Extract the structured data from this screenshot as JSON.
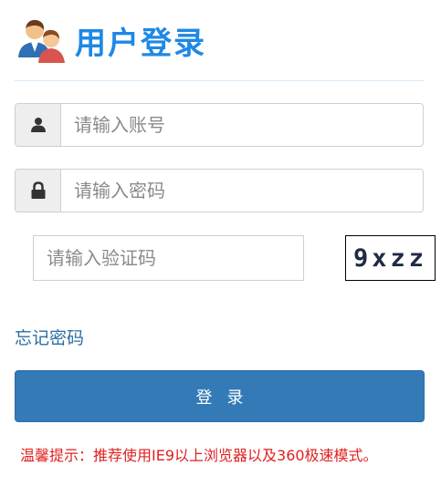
{
  "header": {
    "title": "用户登录",
    "icon": "users-icon"
  },
  "form": {
    "username": {
      "placeholder": "请输入账号",
      "value": "",
      "icon": "user-icon"
    },
    "password": {
      "placeholder": "请输入密码",
      "value": "",
      "icon": "lock-icon"
    },
    "captcha": {
      "placeholder": "请输入验证码",
      "value": "",
      "image_text": "9xzz"
    },
    "forgot_label": "忘记密码",
    "login_label": "登录"
  },
  "tip": "温馨提示：推荐使用IE9以上浏览器以及360极速模式。",
  "colors": {
    "title": "#1e88e5",
    "button": "#337ab7",
    "link": "#2e6da4",
    "tip": "#e02020"
  }
}
